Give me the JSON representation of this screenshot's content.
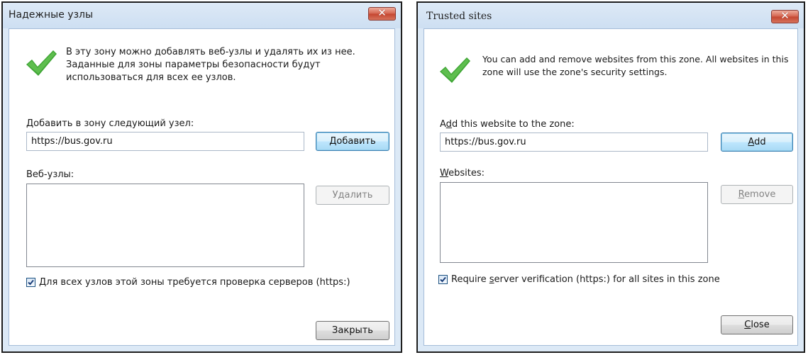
{
  "left_dialog": {
    "title": "Надежные узлы",
    "close_label": "✕",
    "description": "В эту зону можно добавлять веб-узлы и удалять их из нее. Заданные для зоны параметры безопасности будут использоваться для всех ее узлов.",
    "add_label": "Добавить в зону следующий узел:",
    "url_value": "https://bus.gov.ru",
    "add_button": "Добавить",
    "websites_label": "Веб-узлы:",
    "remove_button": "Удалить",
    "checkbox_label": "Для всех узлов этой зоны требуется проверка серверов (https:)",
    "checkbox_checked": true,
    "close_button": "Закрыть"
  },
  "right_dialog": {
    "title": "Trusted sites",
    "close_label": "✕",
    "description": "You can add and remove websites from this zone. All websites in this zone will use the zone's security settings.",
    "add_label_pre": "A",
    "add_label_key": "d",
    "add_label_post": "d this website to the zone:",
    "url_value": "https://bus.gov.ru",
    "add_button_key": "A",
    "add_button_rest": "dd",
    "websites_label_key": "W",
    "websites_label_rest": "ebsites:",
    "remove_button_key": "R",
    "remove_button_rest": "emove",
    "checkbox_label_pre": "Require ",
    "checkbox_label_key": "s",
    "checkbox_label_post": "erver verification (https:) for all sites in this zone",
    "checkbox_checked": true,
    "close_button_key": "C",
    "close_button_rest": "lose"
  },
  "icons": {
    "success": "green-checkmark-icon",
    "close": "close-icon",
    "checkbox": "checkbox-checked-icon"
  },
  "colors": {
    "frame": "#dce9f6",
    "close_red": "#c44630",
    "check_green": "#3fa535",
    "default_button_blue": "#3c7fb1"
  }
}
